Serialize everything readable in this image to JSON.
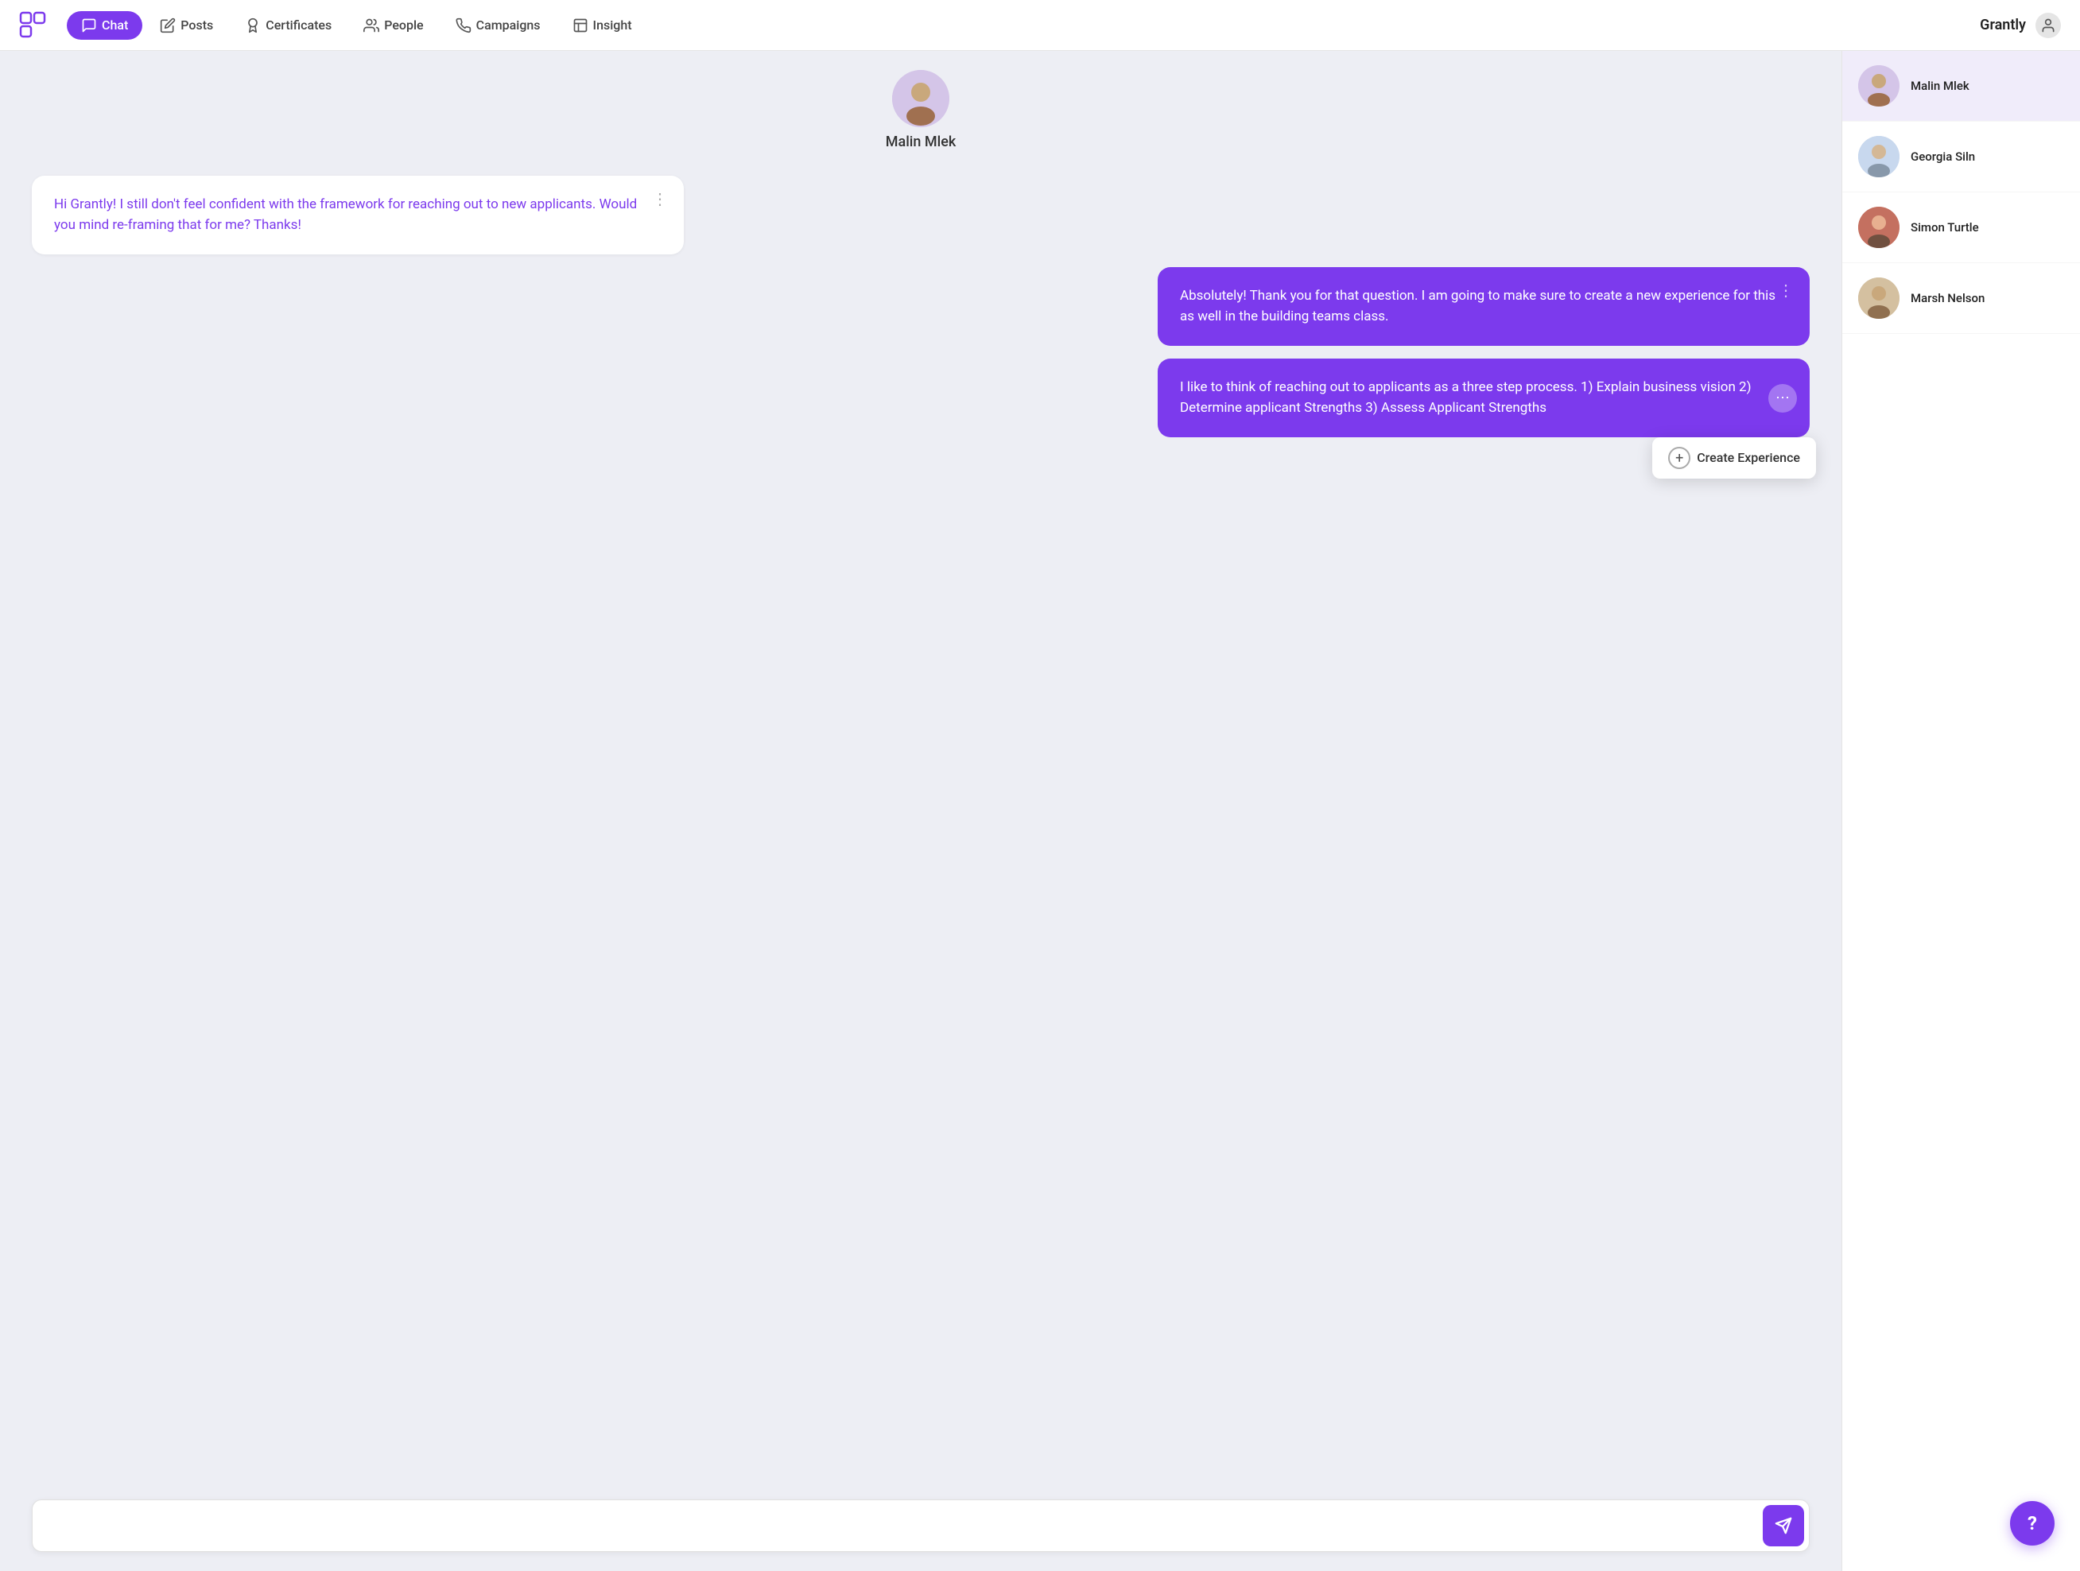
{
  "brand": "Grantly",
  "nav": {
    "logo_label": "logo",
    "items": [
      {
        "id": "chat",
        "label": "Chat",
        "icon": "💬",
        "active": true
      },
      {
        "id": "posts",
        "label": "Posts",
        "icon": "✏️",
        "active": false
      },
      {
        "id": "certificates",
        "label": "Certificates",
        "icon": "🎓",
        "active": false
      },
      {
        "id": "people",
        "label": "People",
        "icon": "👥",
        "active": false
      },
      {
        "id": "campaigns",
        "label": "Campaigns",
        "icon": "📡",
        "active": false
      },
      {
        "id": "insight",
        "label": "Insight",
        "icon": "💡",
        "active": false
      }
    ]
  },
  "chat": {
    "active_user": {
      "name": "Malin Mlek",
      "avatar_emoji": "👩"
    },
    "messages": [
      {
        "id": "msg1",
        "type": "received",
        "text": "Hi Grantly! I still don't feel confident with the framework for reaching out to new applicants. Would you mind re-framing that for me? Thanks!",
        "has_menu": true
      },
      {
        "id": "msg2",
        "type": "sent",
        "text": "Absolutely! Thank you for that question. I am going to make sure to create a new experience for this as well in the building teams class.",
        "has_menu": true
      },
      {
        "id": "msg3",
        "type": "sent",
        "text": "I like to think of reaching out to applicants as a three step process. 1) Explain business vision 2) Determine applicant Strengths 3) Assess Applicant Strengths",
        "has_menu": true,
        "context_menu": true,
        "context_menu_label": "Create Experience"
      }
    ],
    "input_placeholder": ""
  },
  "contacts": [
    {
      "id": "malin",
      "name": "Malin Mlek",
      "avatar_emoji": "👩",
      "active": true,
      "avatar_class": "av-malin"
    },
    {
      "id": "georgia",
      "name": "Georgia Siln",
      "avatar_emoji": "👴",
      "active": false,
      "avatar_class": "av-georgia"
    },
    {
      "id": "simon",
      "name": "Simon Turtle",
      "avatar_emoji": "👨",
      "active": false,
      "avatar_class": "av-simon"
    },
    {
      "id": "marsh",
      "name": "Marsh Nelson",
      "avatar_emoji": "👩",
      "active": false,
      "avatar_class": "av-marsh"
    }
  ],
  "help_button_label": "?",
  "send_button_label": "➤"
}
